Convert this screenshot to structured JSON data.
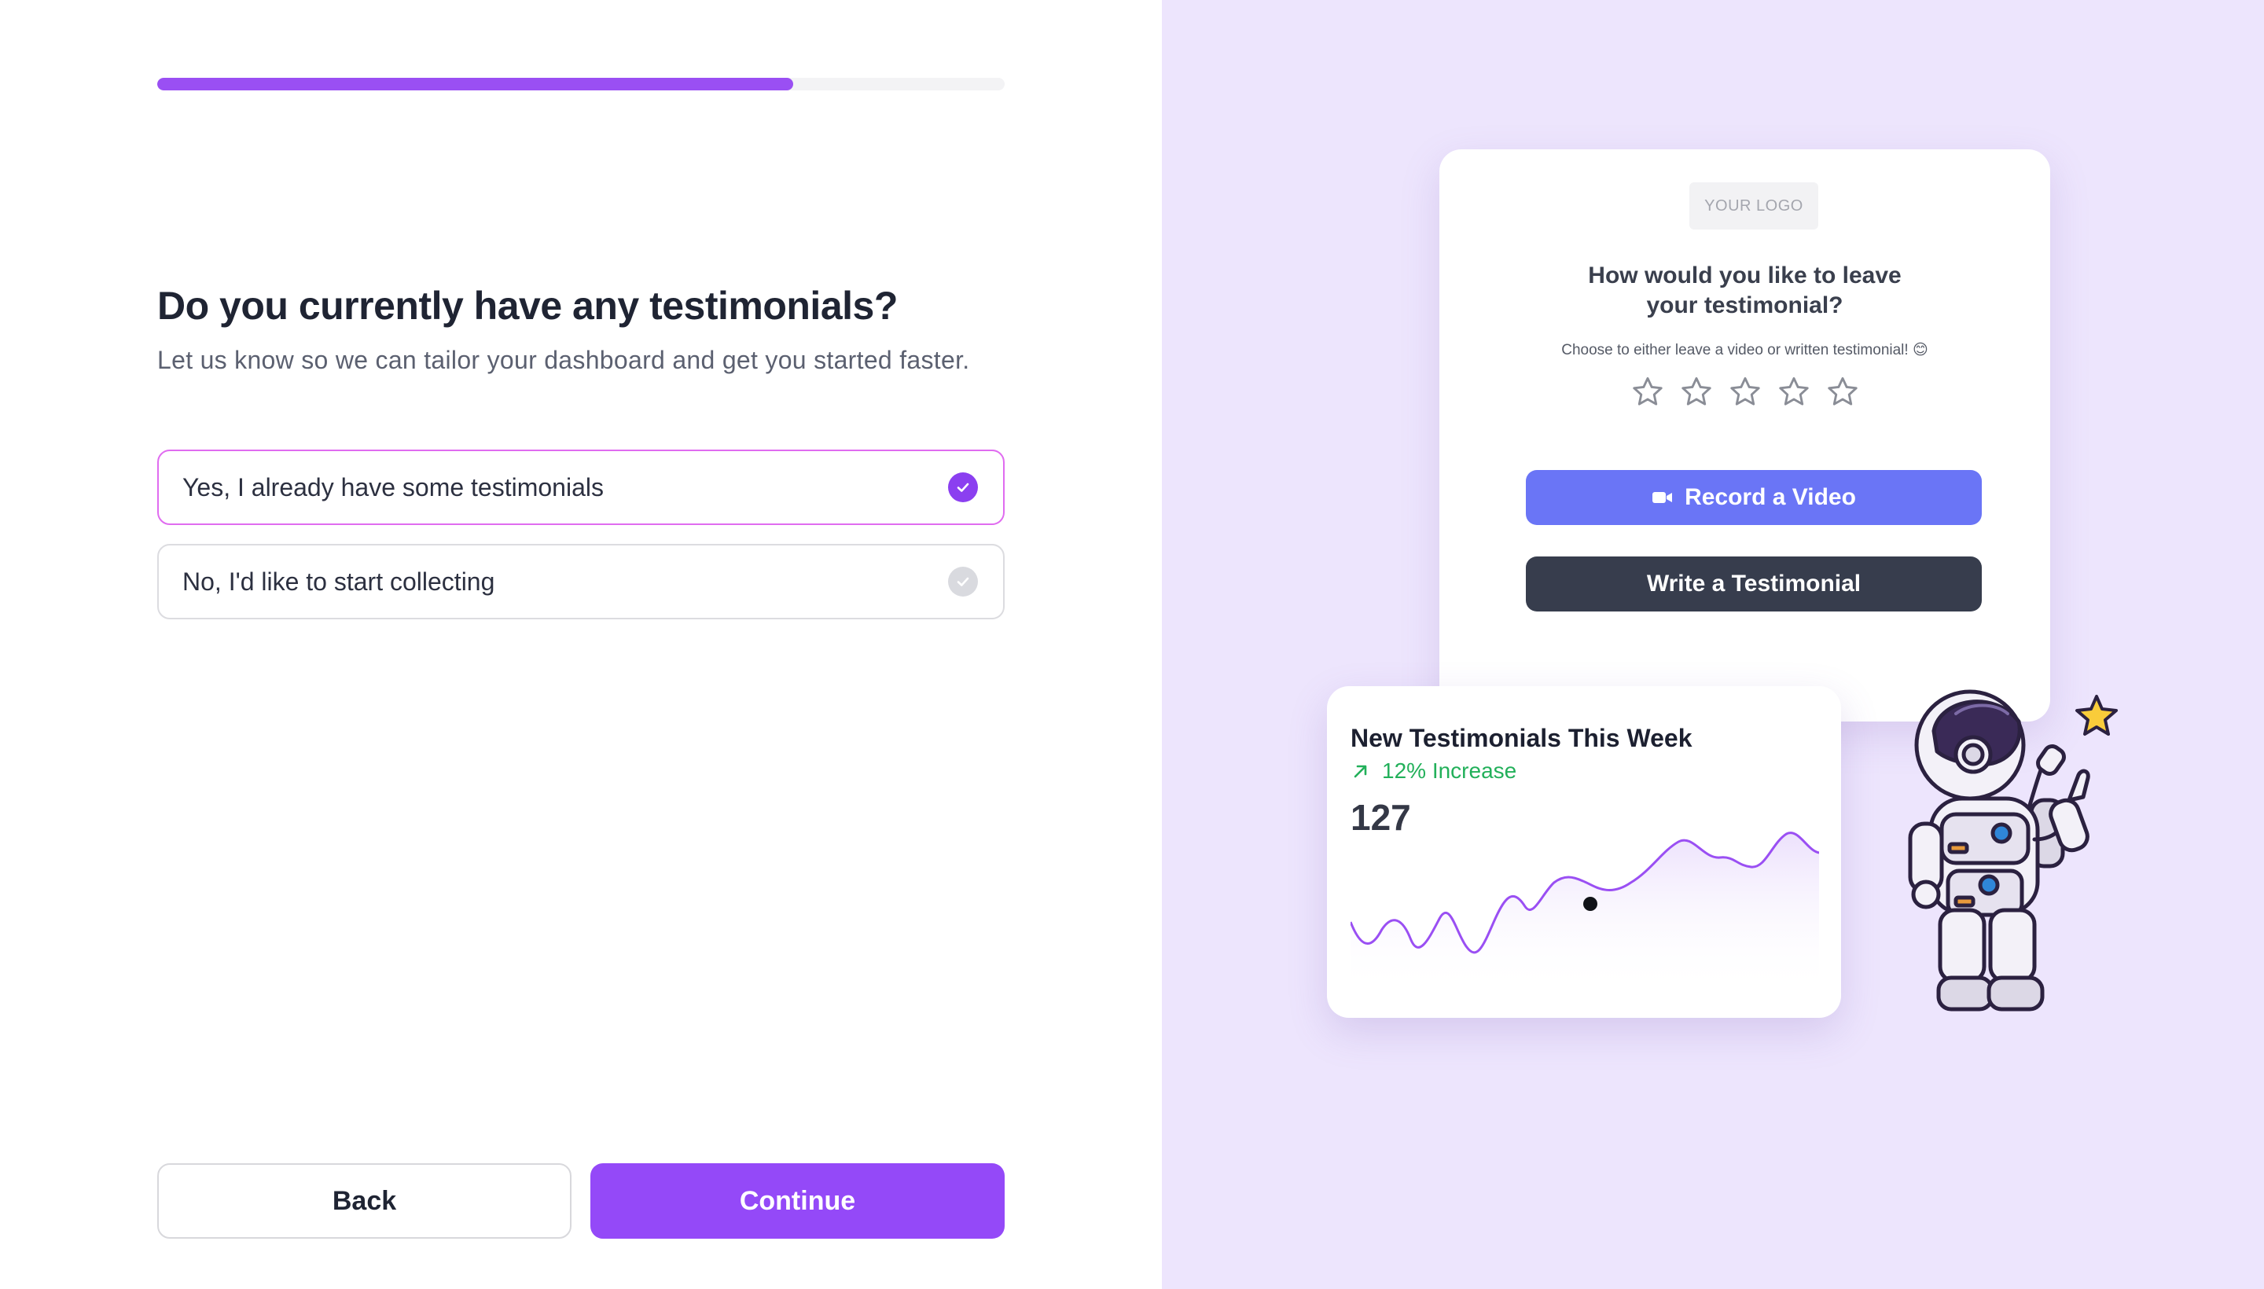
{
  "onboarding": {
    "progress_percent": 75,
    "question": "Do you currently have any testimonials?",
    "subtitle": "Let us know so we can tailor your dashboard and get you started faster.",
    "options": [
      {
        "label": "Yes, I already have some testimonials",
        "selected": true
      },
      {
        "label": "No, I'd like to start collecting",
        "selected": false
      }
    ],
    "back_label": "Back",
    "continue_label": "Continue"
  },
  "preview_card": {
    "logo_text": "YOUR LOGO",
    "title": "How would you like to leave your testimonial?",
    "subtitle": "Choose to either leave a video or written testimonial! 😊",
    "star_count": 5,
    "record_label": "Record a Video",
    "record_icon": "video-camera-icon",
    "write_label": "Write a Testimonial"
  },
  "stats_card": {
    "title": "New Testimonials This Week",
    "trend_label": "12% Increase",
    "trend_icon": "arrow-up-right-icon",
    "value": "127"
  },
  "colors": {
    "accent": "#9449f8",
    "progress": "#9a4ff3",
    "selected_border": "#e06cf0",
    "right_panel_bg": "#ede5fd",
    "record_button": "#6a75f6",
    "write_button": "#373d4d",
    "trend_green": "#22b05a"
  }
}
